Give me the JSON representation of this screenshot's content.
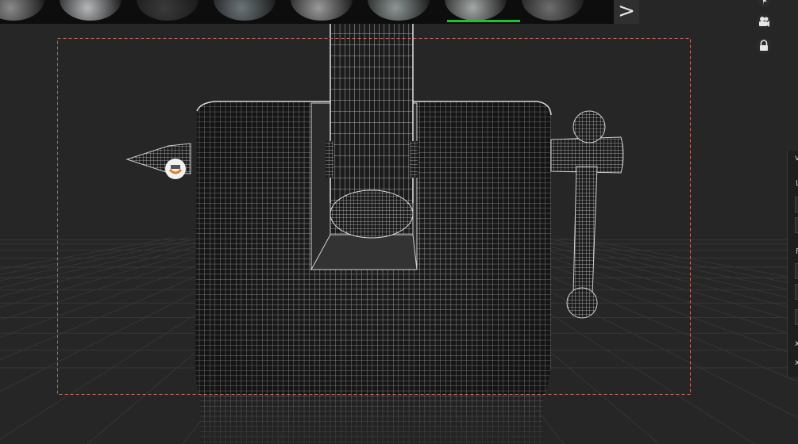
{
  "materials": [
    {
      "name": "material-sphere-1",
      "color": "#8a8a8a"
    },
    {
      "name": "material-sphere-2",
      "color": "#b5b8ba"
    },
    {
      "name": "material-sphere-3",
      "color": "#3a3a3a"
    },
    {
      "name": "material-sphere-4",
      "color": "#6b7478"
    },
    {
      "name": "material-sphere-5",
      "color": "#9a9a9a"
    },
    {
      "name": "material-sphere-6",
      "color": "#8d9695"
    },
    {
      "name": "material-sphere-7",
      "color": "#a4a8a7"
    },
    {
      "name": "material-sphere-8",
      "color": "#6e6e6e"
    }
  ],
  "selected_material": 6,
  "nav": {
    "next_icon": "chevron-right-icon",
    "next_glyph": ">"
  },
  "right_tools": {
    "camera_icon": "video-camera-icon",
    "lock_icon": "lock-icon",
    "top_icon": "cursor-icon"
  },
  "side_panel": {
    "label_1": "L",
    "label_2": "F",
    "chevron": "v",
    "close_1": "x",
    "close_2": "x"
  },
  "colors": {
    "background": "#262626",
    "wire": "#c8c8c8",
    "selection_frame": "#c06a5a",
    "accent": "#1fbf3a"
  }
}
